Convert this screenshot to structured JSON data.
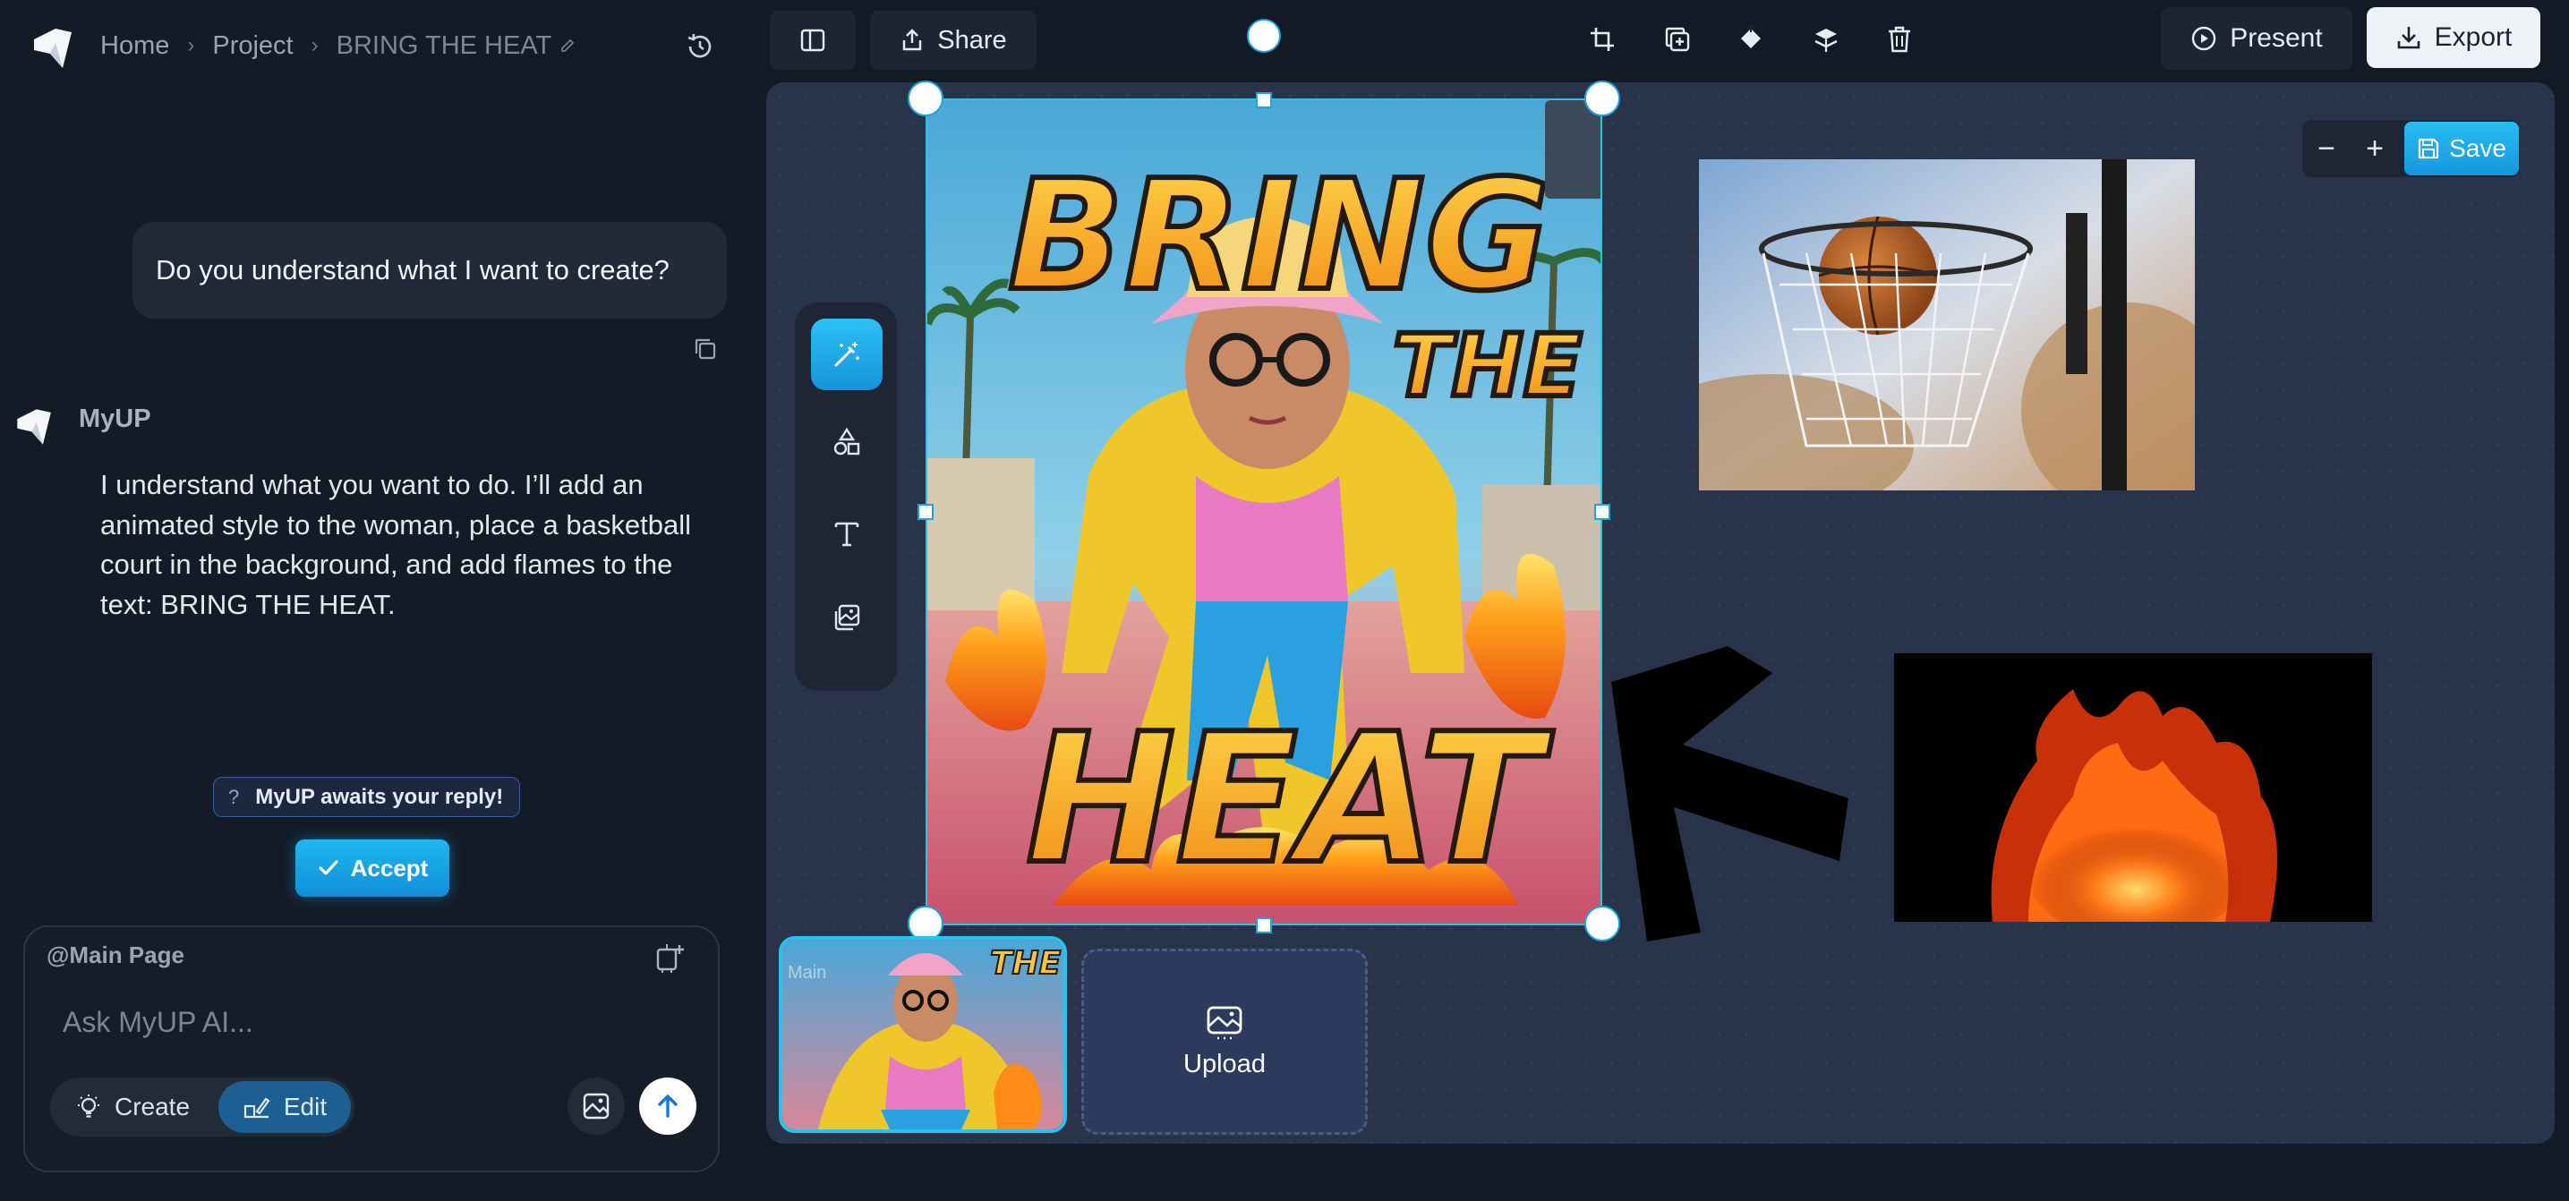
{
  "breadcrumb": {
    "home": "Home",
    "project": "Project",
    "current": "BRING THE HEAT"
  },
  "chat": {
    "user_message": "Do you understand what I want to create?",
    "bot_name": "MyUP",
    "bot_message": "I understand what you want to do. I’ll add an animated style to the woman, place a basketball court in the background, and add flames to the text: BRING THE HEAT.",
    "await_badge": "MyUP awaits your reply!",
    "await_icon": "?",
    "accept_label": "Accept"
  },
  "composer": {
    "page_tag": "@Main Page",
    "placeholder": "Ask MyUP AI...",
    "mode_create": "Create",
    "mode_edit": "Edit",
    "active_mode": "Edit"
  },
  "toolbar": {
    "share_label": "Share",
    "present_label": "Present",
    "export_label": "Export"
  },
  "canvas": {
    "zoom_out": "−",
    "zoom_in": "+",
    "save_label": "Save",
    "poster_text": {
      "line1": "BRING",
      "line2": "THE",
      "line3": "HEAT"
    },
    "page_thumb_label": "Main",
    "upload_label": "Upload"
  },
  "colors": {
    "accent": "#1fb3ee",
    "background": "#121a26",
    "canvas": "#29344a",
    "edit_mode": "#1d5f92"
  },
  "icons": {
    "rail": [
      "magic-wand-icon",
      "shapes-icon",
      "text-icon",
      "images-icon"
    ],
    "toolbar": [
      "crop-icon",
      "duplicate-icon",
      "bring-forward-icon",
      "send-backward-icon",
      "trash-icon"
    ]
  }
}
